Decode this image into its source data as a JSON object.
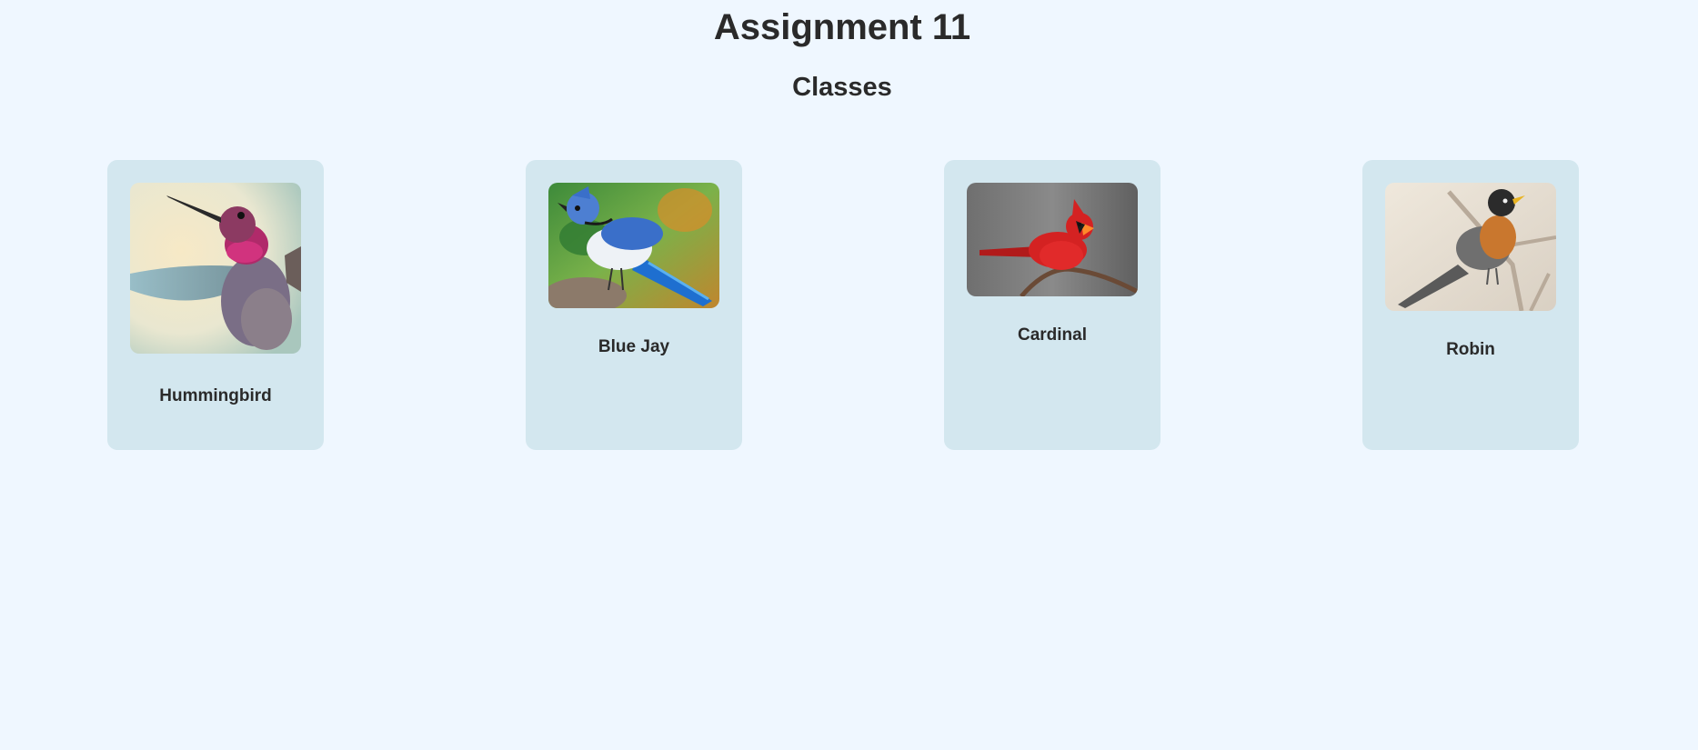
{
  "page": {
    "title": "Assignment 11",
    "subtitle": "Classes"
  },
  "birds": [
    {
      "name": "Hummingbird",
      "image_icon": "hummingbird-photo"
    },
    {
      "name": "Blue Jay",
      "image_icon": "blue-jay-photo"
    },
    {
      "name": "Cardinal",
      "image_icon": "cardinal-photo"
    },
    {
      "name": "Robin",
      "image_icon": "robin-photo"
    }
  ],
  "colors": {
    "background": "#eff7ff",
    "card": "#d3e7ef",
    "text": "#2a2a2a"
  }
}
